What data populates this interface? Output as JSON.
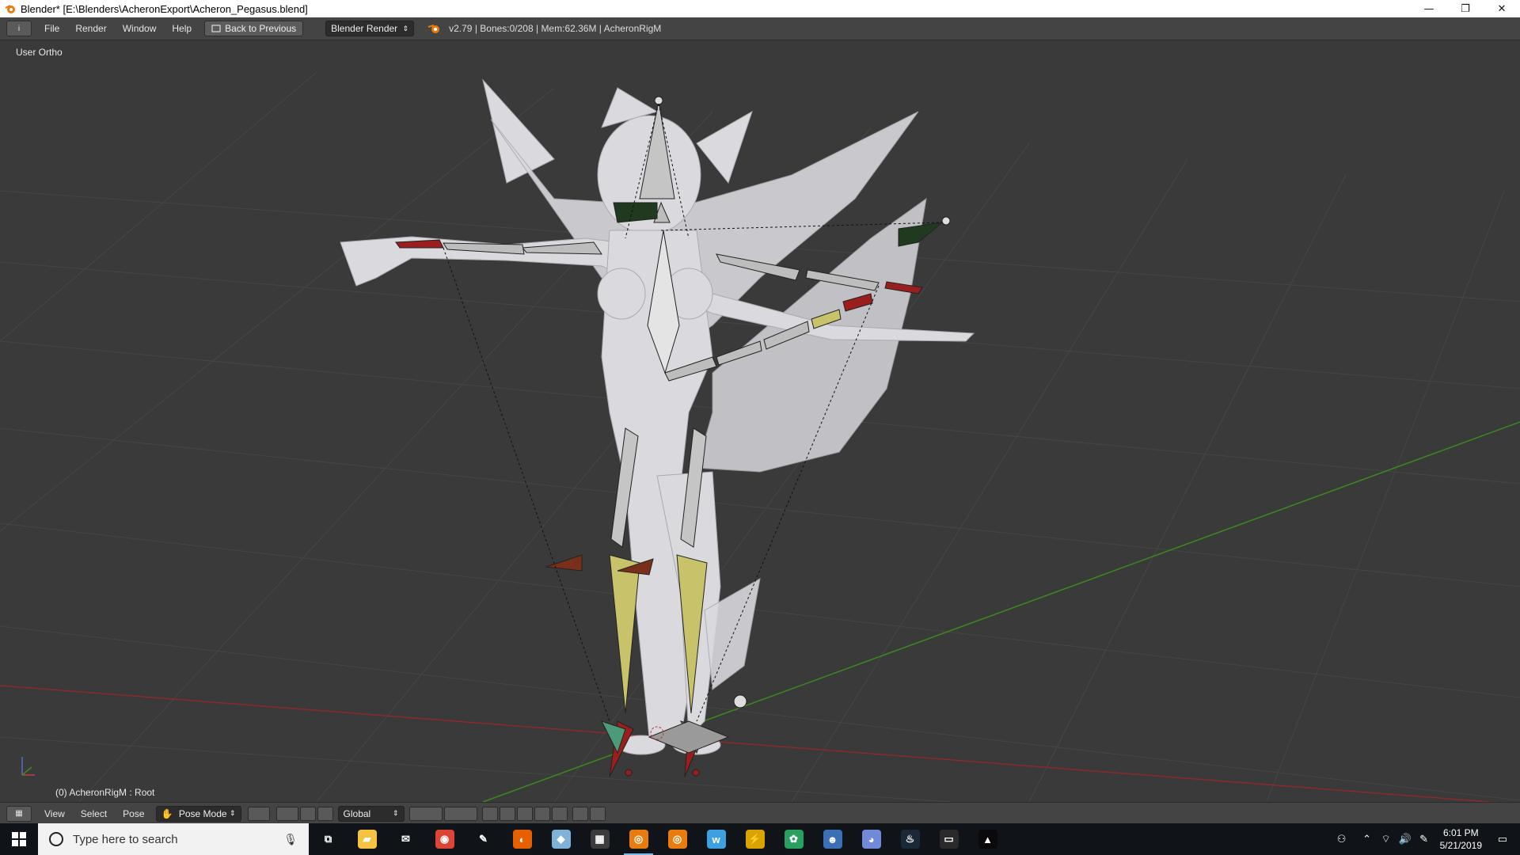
{
  "window": {
    "title": "Blender* [E:\\Blenders\\AcheronExport\\Acheron_Pegasus.blend]",
    "minimize": "—",
    "restore": "❐",
    "close": "✕"
  },
  "info_header": {
    "editor_icon": "i",
    "menus": [
      "File",
      "Render",
      "Window",
      "Help"
    ],
    "back_button": "Back to Previous",
    "engine": "Blender Render",
    "stats": "v2.79 | Bones:0/208  | Mem:62.36M | AcheronRigM"
  },
  "viewport": {
    "view_label": "User Ortho",
    "object_label": "(0) AcheronRigM : Root"
  },
  "view3d_header": {
    "menus": [
      "View",
      "Select",
      "Pose"
    ],
    "mode": "Pose Mode",
    "orientation": "Global"
  },
  "taskbar": {
    "search_placeholder": "Type here to search",
    "time": "6:01 PM",
    "date": "5/21/2019",
    "apps": [
      {
        "name": "task-view-icon",
        "glyph": "⧉",
        "color": "transparent"
      },
      {
        "name": "file-explorer-icon",
        "glyph": "▰",
        "color": "#f5c242"
      },
      {
        "name": "mail-icon",
        "glyph": "✉",
        "color": "transparent"
      },
      {
        "name": "chrome-icon",
        "glyph": "◉",
        "color": "#db4437"
      },
      {
        "name": "tool-icon",
        "glyph": "✎",
        "color": "transparent"
      },
      {
        "name": "firefox-icon",
        "glyph": "◐",
        "color": "#e66000"
      },
      {
        "name": "paint-icon",
        "glyph": "◆",
        "color": "#7fb2d6"
      },
      {
        "name": "calculator-icon",
        "glyph": "▦",
        "color": "#3c3c3c"
      },
      {
        "name": "blender-icon",
        "glyph": "◎",
        "color": "#e87d0d"
      },
      {
        "name": "blender-alt-icon",
        "glyph": "◎",
        "color": "#e87d0d"
      },
      {
        "name": "w-app-icon",
        "glyph": "w",
        "color": "#3da0e0"
      },
      {
        "name": "bolt-icon",
        "glyph": "⚡",
        "color": "#d9a400"
      },
      {
        "name": "green-app-icon",
        "glyph": "✿",
        "color": "#27a060"
      },
      {
        "name": "game-app-icon",
        "glyph": "☻",
        "color": "#3b6fb6"
      },
      {
        "name": "discord-icon",
        "glyph": "◕",
        "color": "#7289da"
      },
      {
        "name": "steam-icon",
        "glyph": "♨",
        "color": "#1b2838"
      },
      {
        "name": "window-app-icon",
        "glyph": "▭",
        "color": "#2a2a2a"
      },
      {
        "name": "photos-icon",
        "glyph": "▲",
        "color": "#0a0a0a"
      }
    ]
  },
  "colors": {
    "viewport_bg": "#3a3a3a",
    "grid": "#464646",
    "x_axis": "#8a2a2a",
    "y_axis": "#3c8a1e",
    "mesh": "#d9d9de",
    "bone": "#bdbdbd",
    "bone_yellow": "#c8c26a",
    "bone_red": "#9a1e1e",
    "bone_green": "#1f3a1f"
  }
}
